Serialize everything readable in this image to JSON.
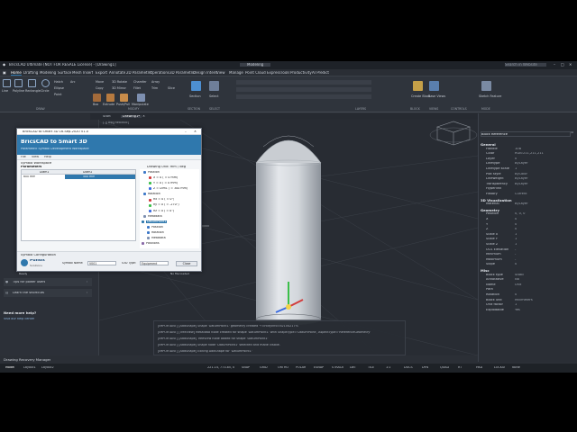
{
  "window": {
    "title": "BricsCAD Ultimate (NOT FOR RESALE License) - [Drawing1]",
    "workspace": "Modeling",
    "search_placeholder": "Search in Website"
  },
  "menu": [
    "File",
    "Edit",
    "View",
    "Insert",
    "Format",
    "Tools",
    "Draw",
    "Dimension",
    "Modify",
    "Parametric",
    "Window",
    "Help"
  ],
  "ribbon": {
    "tabs": [
      "Home",
      "Drafting",
      "Modeling",
      "Surface",
      "Mesh",
      "Insert",
      "Export",
      "Annotate",
      "2D Parametric",
      "Operations",
      "3D Parametric",
      "Design Intent",
      "View",
      "Manage",
      "Point Cloud",
      "ExpressTools",
      "Productivity",
      "AI Predict"
    ],
    "active_tab": "Home",
    "groups": [
      "DRAW",
      "MODIFY",
      "SECTION",
      "SELECT",
      "LAYERS",
      "BLOCK",
      "VIEWS",
      "CONTROLS",
      "MODE"
    ],
    "draw_tools": [
      "Line",
      "Polyline",
      "Rectangle",
      "Circle",
      "Hatch",
      "Ellipse",
      "Point",
      "Arc"
    ],
    "modify_tools": [
      "Move",
      "Copy",
      "Rotate",
      "Scale",
      "3D Rotate",
      "3D Mirror",
      "Chamfer",
      "Fillet",
      "Array",
      "Trim",
      "Box",
      "Extrude",
      "Push/Pull",
      "Manipulate",
      "Offset",
      "Slice"
    ],
    "other_tools": [
      "Section",
      "Select",
      "Layers",
      "Create Block",
      "Base Views",
      "Sketch Feature"
    ]
  },
  "doc_tabs": [
    "Start",
    "Drawing1*"
  ],
  "viewport_label": "[-][Top][Realistic]",
  "dialog": {
    "title": "BricsCAD to Smart 3D 16-Sep-2020 V1.0",
    "heading": "BricsCAD to Smart 3D",
    "subheading": "Parametric Symbol Development Workspace",
    "menu": [
      "File",
      "View",
      "Help"
    ],
    "workspace_label": "Symbol Workspace",
    "parameters_label": "Parameters",
    "drawing_unit_label": "Drawing Unit: mm / deg",
    "grid_headers": [
      "Diam1",
      "Diam2"
    ],
    "grid_row": [
      "600 mm",
      "500 mm"
    ],
    "tree": [
      "Position",
      "X = 0 ( = 0 mm)",
      "Y = 0 ( = 0 mm)",
      "Z = Dim1 ( = 300 mm)",
      "Rotation",
      "Rx = 0 ( = 0°)",
      "Ry = 0 ( = -270°)",
      "Rz = 0 ( = 0°)",
      "Metadata",
      "DatumPoint1",
      "Position",
      "Rotation",
      "Metadata",
      "Positions"
    ],
    "config_label": "Symbol Configuration",
    "symbol_name_label": "Symbol Name:",
    "symbol_name_value": "V001",
    "s3d_type_label": "S3D Type:",
    "s3d_type_value": "Equipment",
    "close_button": "Close",
    "brand": "Pundit",
    "brand_sub": "Solutions",
    "status_left": "Ready",
    "status_right": "No file loaded"
  },
  "welcome": {
    "items": [
      "Tips for power users",
      "Learn the shortcuts"
    ],
    "help_title": "Need more help?",
    "help_link": "Visit our help center"
  },
  "command_lines": [
    "[IMPORTANT] [AddShape] Shape 'DatumPoint1' geometry created → EntityInfo=d2104217%",
    "[IMPORTANT] [TreeView] Metadata node created for shape 'DatumPoint1' with ShapeType='DatumPoint', AspectType='ReferenceGeometry'",
    "[IMPORTANT] [AddShape] TreeView node added for shape 'DatumPoint1'",
    "[IMPORTANT] [AddShape] Shape node 'DatumPoint1' selected and made visible.",
    "[IMPORTANT] [AddShape] Exiting AddShape for 'DatumPoint1'"
  ],
  "recovery_label": "Drawing Recovery Manager",
  "properties": {
    "title": "Block Reference",
    "general_label": "General",
    "general": [
      [
        "Handle",
        "10B"
      ],
      [
        "Color",
        "RGB:211,211,211"
      ],
      [
        "Layer",
        "0"
      ],
      [
        "Linetype",
        "ByLayer"
      ],
      [
        "Linetype scale",
        "1"
      ],
      [
        "Plot style",
        "ByColor"
      ],
      [
        "Lineweight",
        "ByLayer"
      ],
      [
        "Transparency",
        "ByLayer"
      ],
      [
        "Hyperlink",
        ""
      ],
      [
        "History",
        "Current"
      ]
    ],
    "viz_label": "3D Visualization",
    "viz": [
      [
        "Material",
        "ByLayer"
      ]
    ],
    "geometry_label": "Geometry",
    "geometry": [
      [
        "Position",
        "0, 0, 0"
      ],
      [
        "X",
        "0"
      ],
      [
        "Y",
        "0"
      ],
      [
        "Z",
        "0"
      ],
      [
        "Scale X",
        "1"
      ],
      [
        "Scale Y",
        "1"
      ],
      [
        "Scale Z",
        "1"
      ],
      [
        "UCS Elevation",
        "-"
      ],
      [
        "Minimum",
        "-"
      ],
      [
        "Maximum",
        "-"
      ],
      [
        "Slope",
        "0"
      ]
    ],
    "misc_label": "Misc",
    "misc": [
      [
        "Block type",
        "Static"
      ],
      [
        "Annotative",
        "No"
      ],
      [
        "Name",
        "Unit"
      ],
      [
        "Path",
        ""
      ],
      [
        "Rotation",
        "0"
      ],
      [
        "Block unit",
        "Millimeters"
      ],
      [
        "Unit factor",
        "1"
      ],
      [
        "Explodable",
        "Yes"
      ]
    ]
  },
  "status": {
    "coords": "221.14, 773.85, 0",
    "toggles": [
      "SNAP",
      "GRID",
      "ORTHO",
      "POLAR",
      "ESNAP",
      "STRACK",
      "LWT",
      "TILE",
      "1:1",
      "DUCS",
      "DYN",
      "QUAD",
      "RT",
      "HKA",
      "LOCKUI",
      "None"
    ],
    "model_tabs": [
      "Model",
      "Layout1",
      "Layout2"
    ]
  },
  "colors": {
    "accent": "#2f78ad",
    "bg": "#282c33",
    "gizmo_x": "#d23c3c",
    "gizmo_y": "#3cbf4a",
    "gizmo_z": "#3a6be0"
  }
}
